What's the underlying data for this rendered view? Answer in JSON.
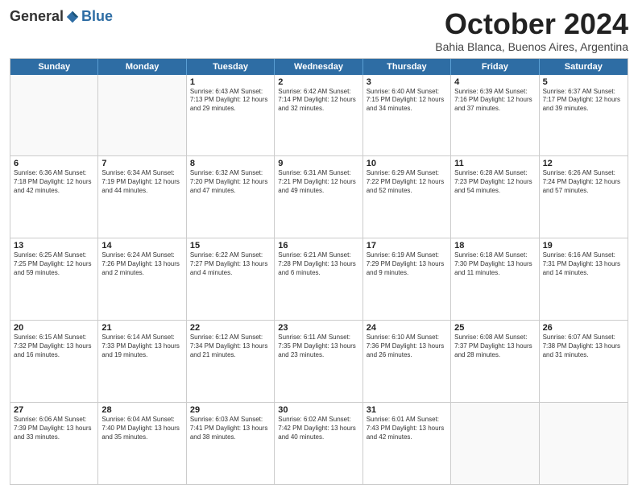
{
  "header": {
    "logo_general": "General",
    "logo_blue": "Blue",
    "month_title": "October 2024",
    "location": "Bahia Blanca, Buenos Aires, Argentina"
  },
  "weekdays": [
    "Sunday",
    "Monday",
    "Tuesday",
    "Wednesday",
    "Thursday",
    "Friday",
    "Saturday"
  ],
  "rows": [
    [
      {
        "day": "",
        "info": ""
      },
      {
        "day": "",
        "info": ""
      },
      {
        "day": "1",
        "info": "Sunrise: 6:43 AM\nSunset: 7:13 PM\nDaylight: 12 hours and 29 minutes."
      },
      {
        "day": "2",
        "info": "Sunrise: 6:42 AM\nSunset: 7:14 PM\nDaylight: 12 hours and 32 minutes."
      },
      {
        "day": "3",
        "info": "Sunrise: 6:40 AM\nSunset: 7:15 PM\nDaylight: 12 hours and 34 minutes."
      },
      {
        "day": "4",
        "info": "Sunrise: 6:39 AM\nSunset: 7:16 PM\nDaylight: 12 hours and 37 minutes."
      },
      {
        "day": "5",
        "info": "Sunrise: 6:37 AM\nSunset: 7:17 PM\nDaylight: 12 hours and 39 minutes."
      }
    ],
    [
      {
        "day": "6",
        "info": "Sunrise: 6:36 AM\nSunset: 7:18 PM\nDaylight: 12 hours and 42 minutes."
      },
      {
        "day": "7",
        "info": "Sunrise: 6:34 AM\nSunset: 7:19 PM\nDaylight: 12 hours and 44 minutes."
      },
      {
        "day": "8",
        "info": "Sunrise: 6:32 AM\nSunset: 7:20 PM\nDaylight: 12 hours and 47 minutes."
      },
      {
        "day": "9",
        "info": "Sunrise: 6:31 AM\nSunset: 7:21 PM\nDaylight: 12 hours and 49 minutes."
      },
      {
        "day": "10",
        "info": "Sunrise: 6:29 AM\nSunset: 7:22 PM\nDaylight: 12 hours and 52 minutes."
      },
      {
        "day": "11",
        "info": "Sunrise: 6:28 AM\nSunset: 7:23 PM\nDaylight: 12 hours and 54 minutes."
      },
      {
        "day": "12",
        "info": "Sunrise: 6:26 AM\nSunset: 7:24 PM\nDaylight: 12 hours and 57 minutes."
      }
    ],
    [
      {
        "day": "13",
        "info": "Sunrise: 6:25 AM\nSunset: 7:25 PM\nDaylight: 12 hours and 59 minutes."
      },
      {
        "day": "14",
        "info": "Sunrise: 6:24 AM\nSunset: 7:26 PM\nDaylight: 13 hours and 2 minutes."
      },
      {
        "day": "15",
        "info": "Sunrise: 6:22 AM\nSunset: 7:27 PM\nDaylight: 13 hours and 4 minutes."
      },
      {
        "day": "16",
        "info": "Sunrise: 6:21 AM\nSunset: 7:28 PM\nDaylight: 13 hours and 6 minutes."
      },
      {
        "day": "17",
        "info": "Sunrise: 6:19 AM\nSunset: 7:29 PM\nDaylight: 13 hours and 9 minutes."
      },
      {
        "day": "18",
        "info": "Sunrise: 6:18 AM\nSunset: 7:30 PM\nDaylight: 13 hours and 11 minutes."
      },
      {
        "day": "19",
        "info": "Sunrise: 6:16 AM\nSunset: 7:31 PM\nDaylight: 13 hours and 14 minutes."
      }
    ],
    [
      {
        "day": "20",
        "info": "Sunrise: 6:15 AM\nSunset: 7:32 PM\nDaylight: 13 hours and 16 minutes."
      },
      {
        "day": "21",
        "info": "Sunrise: 6:14 AM\nSunset: 7:33 PM\nDaylight: 13 hours and 19 minutes."
      },
      {
        "day": "22",
        "info": "Sunrise: 6:12 AM\nSunset: 7:34 PM\nDaylight: 13 hours and 21 minutes."
      },
      {
        "day": "23",
        "info": "Sunrise: 6:11 AM\nSunset: 7:35 PM\nDaylight: 13 hours and 23 minutes."
      },
      {
        "day": "24",
        "info": "Sunrise: 6:10 AM\nSunset: 7:36 PM\nDaylight: 13 hours and 26 minutes."
      },
      {
        "day": "25",
        "info": "Sunrise: 6:08 AM\nSunset: 7:37 PM\nDaylight: 13 hours and 28 minutes."
      },
      {
        "day": "26",
        "info": "Sunrise: 6:07 AM\nSunset: 7:38 PM\nDaylight: 13 hours and 31 minutes."
      }
    ],
    [
      {
        "day": "27",
        "info": "Sunrise: 6:06 AM\nSunset: 7:39 PM\nDaylight: 13 hours and 33 minutes."
      },
      {
        "day": "28",
        "info": "Sunrise: 6:04 AM\nSunset: 7:40 PM\nDaylight: 13 hours and 35 minutes."
      },
      {
        "day": "29",
        "info": "Sunrise: 6:03 AM\nSunset: 7:41 PM\nDaylight: 13 hours and 38 minutes."
      },
      {
        "day": "30",
        "info": "Sunrise: 6:02 AM\nSunset: 7:42 PM\nDaylight: 13 hours and 40 minutes."
      },
      {
        "day": "31",
        "info": "Sunrise: 6:01 AM\nSunset: 7:43 PM\nDaylight: 13 hours and 42 minutes."
      },
      {
        "day": "",
        "info": ""
      },
      {
        "day": "",
        "info": ""
      }
    ]
  ]
}
